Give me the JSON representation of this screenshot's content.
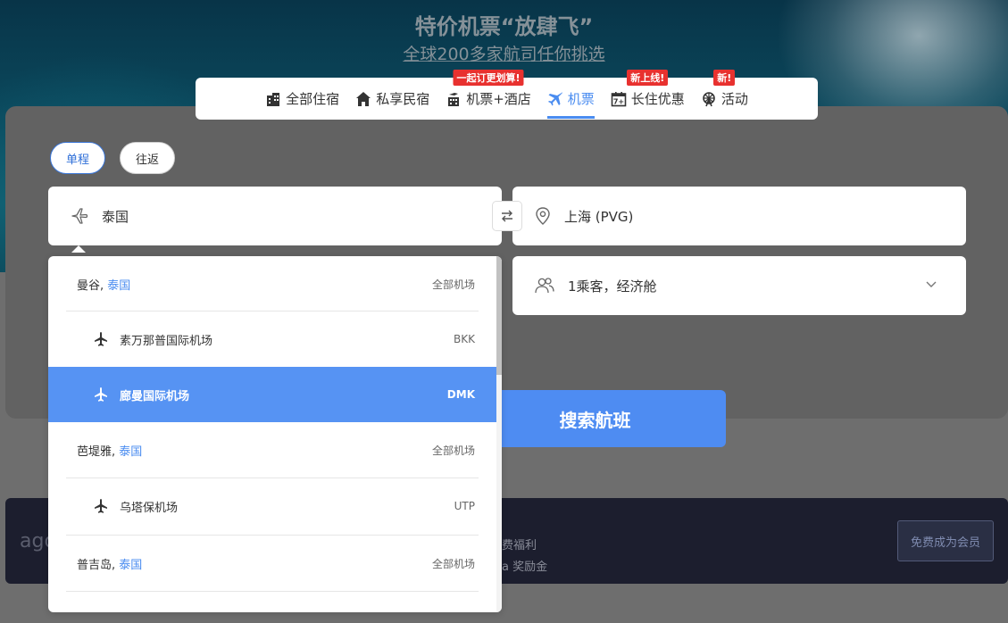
{
  "hero": {
    "title": "特价机票“放肆飞”",
    "subtitle": "全球200多家航司任你挑选"
  },
  "nav": {
    "items": [
      {
        "label": "全部住宿",
        "icon": "buildings-icon",
        "badge": ""
      },
      {
        "label": "私享民宿",
        "icon": "house-icon",
        "badge": ""
      },
      {
        "label": "机票+酒店",
        "icon": "hotel-plane-icon",
        "badge": "一起订更划算!"
      },
      {
        "label": "机票",
        "icon": "airplane-icon",
        "badge": "",
        "active": true
      },
      {
        "label": "长住优惠",
        "icon": "calendar-icon",
        "badge": "新上线!"
      },
      {
        "label": "活动",
        "icon": "ferris-wheel-icon",
        "badge": "新!"
      }
    ]
  },
  "trip_type": {
    "one_way": "单程",
    "round_trip": "往返",
    "selected": "one_way"
  },
  "search": {
    "from_value": "泰国",
    "to_value": "上海 (PVG)",
    "passengers_value": "1乘客，经济舱",
    "search_button": "搜索航班"
  },
  "dropdown": {
    "items": [
      {
        "type": "city",
        "city": "曼谷, ",
        "country": "泰国",
        "code": "全部机场"
      },
      {
        "type": "airport",
        "name": "素万那普国际机场",
        "code": "BKK"
      },
      {
        "type": "airport",
        "name": "廊曼国际机场",
        "code": "DMK",
        "selected": true
      },
      {
        "type": "city",
        "city": "芭堤雅, ",
        "country": "泰国",
        "code": "全部机场"
      },
      {
        "type": "airport",
        "name": "乌塔保机场",
        "code": "UTP"
      },
      {
        "type": "city",
        "city": "普吉岛, ",
        "country": "泰国",
        "code": "全部机场"
      }
    ]
  },
  "member": {
    "logo": "ago",
    "line1": "费福利",
    "line2": "a 奖励金",
    "button": "免费成为会员"
  },
  "colors": {
    "accent": "#4a8cf0",
    "selected_row": "#5693f3",
    "badge": "#e8312f",
    "member_bar": "#1c1e2e"
  }
}
